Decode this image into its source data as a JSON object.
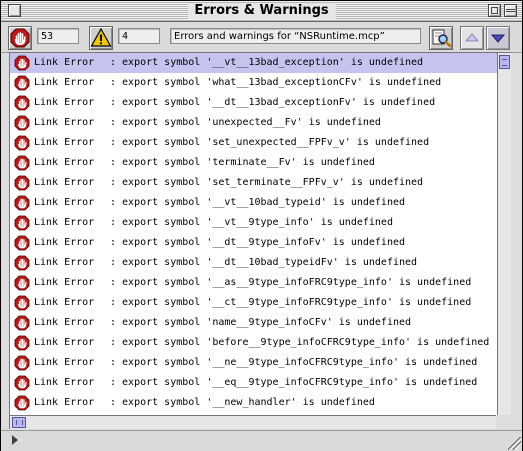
{
  "window": {
    "title": "Errors & Warnings"
  },
  "toolbar": {
    "error_count": "53",
    "warning_count": "4",
    "messages_title": "Errors and warnings for “NSRuntime.mcp”",
    "icons": {
      "errors": "stop-hand-icon",
      "warnings": "warning-triangle-icon",
      "find": "find-magnifier-icon",
      "prev": "chevron-up-icon",
      "next": "chevron-down-icon"
    }
  },
  "colors": {
    "selection": "#c6c3ee",
    "stop_red": "#c01818",
    "warning_yellow": "#f0c800"
  },
  "messages": [
    {
      "kind": "Link Error",
      "text": ": export symbol '__vt__13bad_exception' is undefined",
      "selected": true
    },
    {
      "kind": "Link Error",
      "text": ": export symbol 'what__13bad_exceptionCFv' is undefined"
    },
    {
      "kind": "Link Error",
      "text": ": export symbol '__dt__13bad_exceptionFv' is undefined"
    },
    {
      "kind": "Link Error",
      "text": ": export symbol 'unexpected__Fv' is undefined"
    },
    {
      "kind": "Link Error",
      "text": ": export symbol 'set_unexpected__FPFv_v' is undefined"
    },
    {
      "kind": "Link Error",
      "text": ": export symbol 'terminate__Fv' is undefined"
    },
    {
      "kind": "Link Error",
      "text": ": export symbol 'set_terminate__FPFv_v' is undefined"
    },
    {
      "kind": "Link Error",
      "text": ": export symbol '__vt__10bad_typeid' is undefined"
    },
    {
      "kind": "Link Error",
      "text": ": export symbol '__vt__9type_info' is undefined"
    },
    {
      "kind": "Link Error",
      "text": ": export symbol '__dt__9type_infoFv' is undefined"
    },
    {
      "kind": "Link Error",
      "text": ": export symbol '__dt__10bad_typeidFv' is undefined"
    },
    {
      "kind": "Link Error",
      "text": ": export symbol '__as__9type_infoFRC9type_info' is undefined"
    },
    {
      "kind": "Link Error",
      "text": ": export symbol '__ct__9type_infoFRC9type_info' is undefined"
    },
    {
      "kind": "Link Error",
      "text": ": export symbol 'name__9type_infoCFv' is undefined"
    },
    {
      "kind": "Link Error",
      "text": ": export symbol 'before__9type_infoCFRC9type_info' is undefined"
    },
    {
      "kind": "Link Error",
      "text": ": export symbol '__ne__9type_infoCFRC9type_info' is undefined"
    },
    {
      "kind": "Link Error",
      "text": ": export symbol '__eq__9type_infoCFRC9type_info' is undefined"
    },
    {
      "kind": "Link Error",
      "text": ": export symbol '__new_handler' is undefined"
    }
  ]
}
